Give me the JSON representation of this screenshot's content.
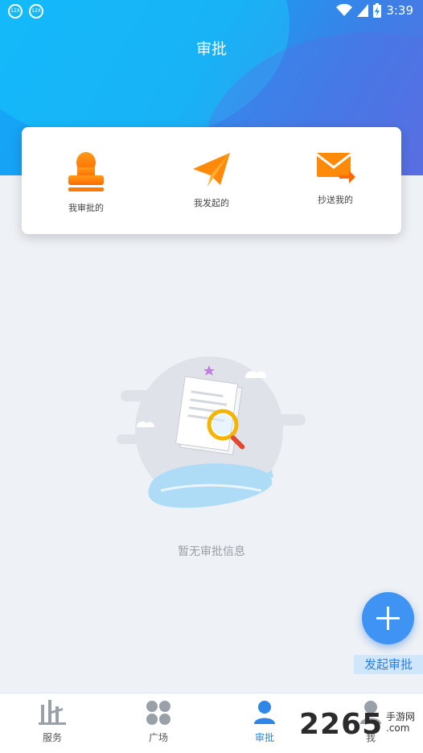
{
  "status_bar": {
    "time": "3:39"
  },
  "header": {
    "title": "审批"
  },
  "quick_actions": [
    {
      "label": "我审批的",
      "icon": "stamp-icon"
    },
    {
      "label": "我发起的",
      "icon": "paper-plane-icon"
    },
    {
      "label": "抄送我的",
      "icon": "mail-forward-icon"
    }
  ],
  "empty_state": {
    "message": "暂无审批信息",
    "icon": "empty-search-illustration"
  },
  "fab": {
    "label": "发起审批",
    "icon": "plus-icon"
  },
  "tabs": [
    {
      "label": "服务",
      "icon": "building-icon"
    },
    {
      "label": "广场",
      "icon": "clover-icon"
    },
    {
      "label": "审批",
      "icon": "person-icon",
      "active": true
    },
    {
      "label": "我",
      "icon": "user-icon"
    }
  ],
  "watermark": {
    "brand": "2265",
    "sub1": "手游网",
    "sub2": ".com"
  },
  "colors": {
    "accent": "#2e86e6",
    "orange": "#ff7a00"
  }
}
